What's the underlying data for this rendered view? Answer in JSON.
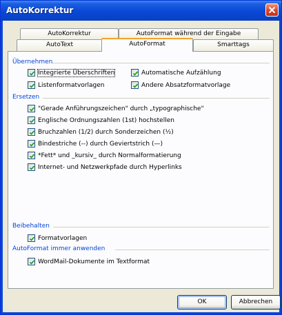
{
  "window": {
    "title": "AutoKorrektur"
  },
  "tabs_back": [
    "AutoKorrektur",
    "AutoFormat während der Eingabe"
  ],
  "tabs_front": [
    "AutoText",
    "AutoFormat",
    "Smarttags"
  ],
  "groups": {
    "uebernehmen": "Übernehmen",
    "ersetzen": "Ersetzen",
    "beibehalten": "Beibehalten",
    "immer": "AutoFormat immer anwenden"
  },
  "options": {
    "integrierte": {
      "label": "Integrierte Überschriften",
      "checked": true
    },
    "aufzaehlung": {
      "label": "Automatische Aufzählung",
      "checked": true
    },
    "listenformat": {
      "label": "Listenformatvorlagen",
      "checked": true
    },
    "absatzformat": {
      "label": "Andere Absatzformatvorlage",
      "checked": true
    },
    "anfuehrung": {
      "label": "\"Gerade Anführungszeichen\" durch „typographische\"",
      "checked": true
    },
    "ordnungszahlen": {
      "label": "Englische Ordnungszahlen (1st) hochstellen",
      "checked": true
    },
    "bruchzahlen": {
      "label": "Bruchzahlen (1/2) durch Sonderzeichen (½)",
      "checked": true
    },
    "bindestriche": {
      "label": "Bindestriche (--) durch Geviertstrich (—)",
      "checked": true
    },
    "fett": {
      "label": "*Fett* und _kursiv_ durch Normalformatierung",
      "checked": true
    },
    "hyperlinks": {
      "label": "Internet- und Netzwerkpfade durch Hyperlinks",
      "checked": true
    },
    "formatvorlagen": {
      "label": "Formatvorlagen",
      "checked": true
    },
    "wordmail": {
      "label": "WordMail-Dokumente im Textformat",
      "checked": true
    }
  },
  "buttons": {
    "ok": "OK",
    "cancel": "Abbrechen"
  }
}
